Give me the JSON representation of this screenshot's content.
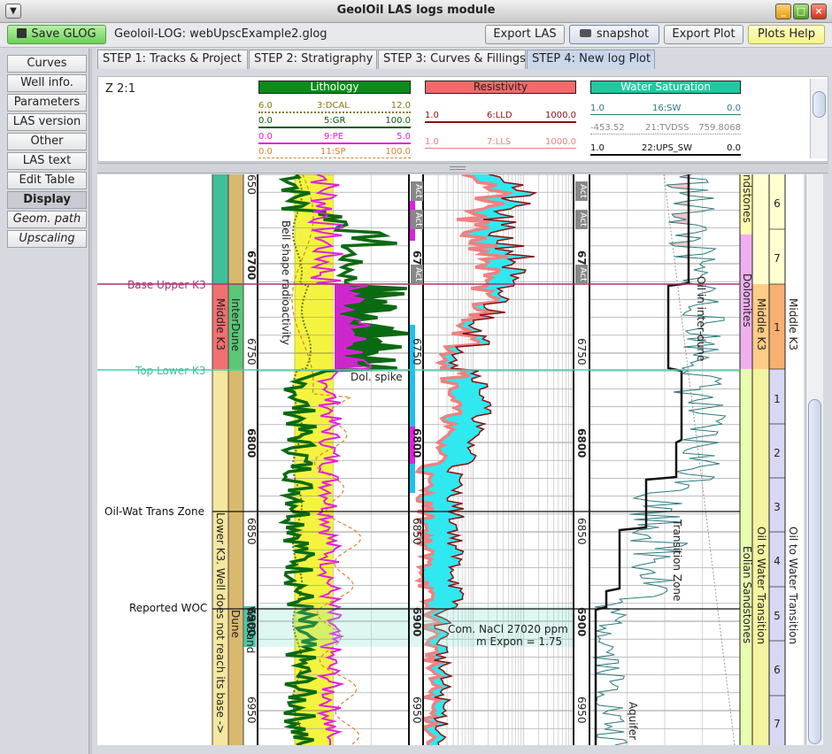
{
  "window": {
    "title": "GeolOil LAS logs module"
  },
  "toolbar": {
    "save": "Save GLOG",
    "project": "Geoloil-LOG: webUpscExample2.glog",
    "export_las": "Export LAS",
    "snapshot": "snapshot",
    "export_plot": "Export Plot",
    "plots_help": "Plots Help"
  },
  "sidebar": {
    "items": [
      "Curves",
      "Well info.",
      "Parameters",
      "LAS version",
      "Other",
      "LAS text",
      "Edit Table",
      "Display",
      "Geom. path",
      "Upscaling"
    ],
    "active": "Display"
  },
  "tabs": [
    "STEP 1: Tracks & Project",
    "STEP 2: Stratigraphy",
    "STEP 3: Curves & Fillings",
    "STEP 4: New log Plot"
  ],
  "active_tab": "STEP 4: New log Plot",
  "header": {
    "scale": "Z 2:1",
    "tracks": [
      {
        "title": "Lithology",
        "color": "#0d8a1a",
        "curves": [
          {
            "min": "6.0",
            "name": "3:DCAL",
            "max": "12.0",
            "color": "#8a7a00"
          },
          {
            "min": "0.0",
            "name": "5:GR",
            "max": "100.0",
            "color": "#0a5a0a"
          },
          {
            "min": "0.0",
            "name": "9:PE",
            "max": "5.0",
            "color": "#e020e0"
          },
          {
            "min": "0.0",
            "name": "11:SP",
            "max": "100.0",
            "color": "#e08030"
          }
        ]
      },
      {
        "title": "Resistivity",
        "color": "#f46a6a",
        "curves": [
          {
            "min": "1.0",
            "name": "6:LLD",
            "max": "1000.0",
            "color": "#8a1010"
          },
          {
            "min": "1.0",
            "name": "7:LLS",
            "max": "1000.0",
            "color": "#f08080"
          }
        ]
      },
      {
        "title": "Water Saturation",
        "color": "#20c8a0",
        "curves": [
          {
            "min": "1.0",
            "name": "16:SW",
            "max": "0.0",
            "color": "#2a7a80"
          },
          {
            "min": "-453.52",
            "name": "21:TVDSS",
            "max": "759.8068",
            "color": "#888888"
          },
          {
            "min": "1.0",
            "name": "22:UPS_SW",
            "max": "0.0",
            "color": "#111111"
          }
        ]
      }
    ]
  },
  "plot": {
    "markers": [
      {
        "label": "Base Upper K3",
        "color": "#b03070"
      },
      {
        "label": "Top Lower K3",
        "color": "#40d0b0"
      },
      {
        "label": "Oil-Wat Trans Zone",
        "color": "#111111"
      },
      {
        "label": "Reported WOC",
        "color": "#111111"
      }
    ],
    "zones": {
      "middle_k3": "Middle K3",
      "interdune": "InterDune",
      "lower_k3": "Lower K3. Well does not reach its base ->",
      "dune": "Dune",
      "watsand": "WatSand"
    },
    "depth_labels": [
      "6700",
      "6750",
      "6800",
      "6850",
      "6900",
      "6950"
    ],
    "top_depth_label": "650",
    "depth_labels_bold": [
      "6700",
      "6800",
      "6900"
    ],
    "annotations": {
      "bell": "Bell shape radioactivity",
      "dol": "Dol. spike",
      "nacl": "Com. NaCl 27020 ppm",
      "mexp": "m Expon = 1.75",
      "oil": "Oil in inter-dune",
      "transition": "Transition Zone",
      "aquifer": "Aquifer"
    },
    "act_label": "Act",
    "right_zones": {
      "sandstones": "ndstones",
      "dolomites": "Dolomites",
      "eolian": "Eolian Sandstones",
      "oil_water": "Oil to Water Transition",
      "middle_k3": "Middle K3",
      "oil_water2": "Oil to Water Transition"
    },
    "layer_numbers_upper": [
      "6",
      "7"
    ],
    "layer_number_middle": "1",
    "layer_numbers_lower": [
      "1",
      "2",
      "3",
      "4",
      "5",
      "6",
      "7"
    ]
  }
}
